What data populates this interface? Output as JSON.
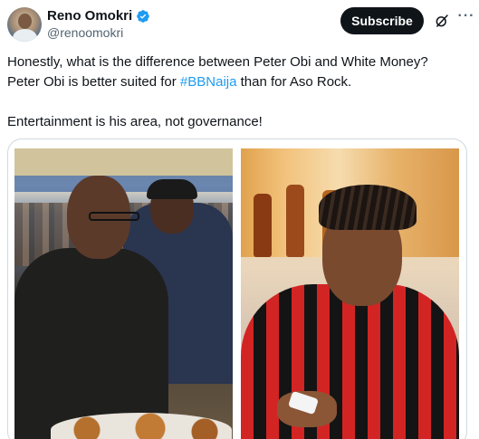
{
  "author": {
    "name": "Reno Omokri",
    "handle": "@renoomokri",
    "verified": true,
    "verified_color": "#1d9bf0"
  },
  "actions": {
    "subscribe_label": "Subscribe",
    "grok_icon": "grok-icon",
    "more_icon": "more-icon"
  },
  "tweet": {
    "line1": "Honestly, what is the difference between Peter Obi and White Money?",
    "line2_before": "Peter Obi is better suited for ",
    "hashtag": "#BBNaija",
    "line2_after": " than for Aso Rock.",
    "line3": "Entertainment is his area, not governance!"
  },
  "colors": {
    "text": "#0f1419",
    "secondary": "#536471",
    "link": "#1d9bf0",
    "button_bg": "#0f1419",
    "border": "#cfd9de"
  }
}
